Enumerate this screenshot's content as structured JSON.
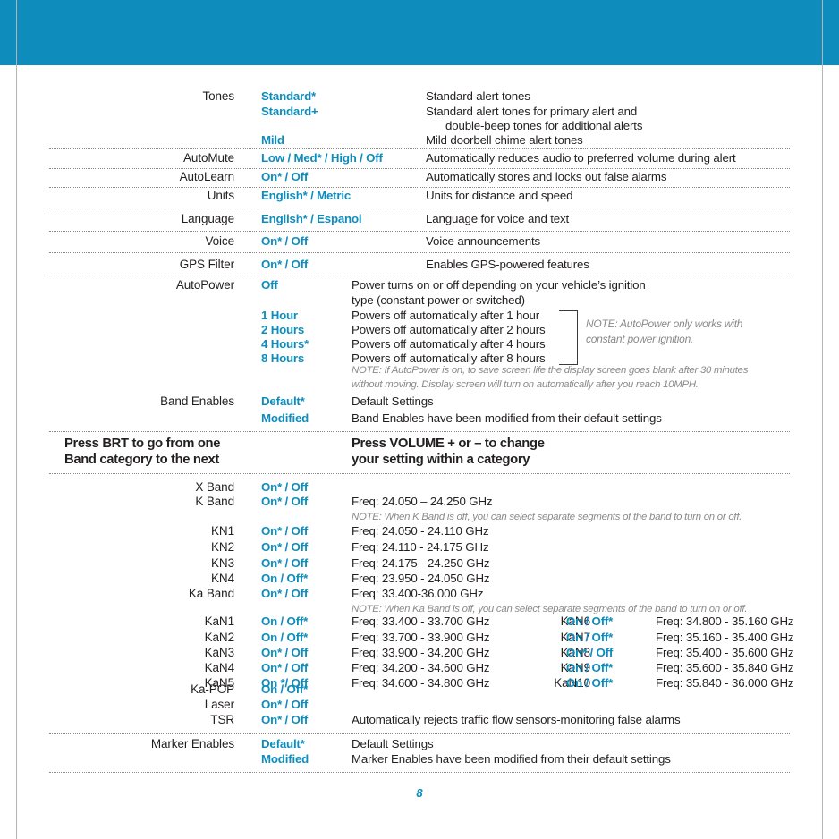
{
  "page": {
    "number": "8",
    "banner_color": "#0e8dbd",
    "accent_color": "#0e8dbd",
    "note_color": "#8a8a8a"
  },
  "settings_rows": [
    {
      "label": "Tones",
      "options": [
        "Standard*",
        "Standard+",
        "Mild"
      ],
      "descriptions": [
        "Standard alert tones",
        "Standard alert tones for primary alert and",
        "double-beep tones for additional alerts",
        "Mild doorbell chime alert tones"
      ]
    },
    {
      "label": "AutoMute",
      "option": "Low / Med* / High / Off",
      "desc": "Automatically reduces audio to preferred volume during alert"
    },
    {
      "label": "AutoLearn",
      "option": "On* / Off",
      "desc": "Automatically stores and locks out false alarms"
    },
    {
      "label": "Units",
      "option": "English* / Metric",
      "desc": "Units for distance and speed"
    },
    {
      "label": "Language",
      "option": "English* / Espanol",
      "desc": "Language for voice and text"
    },
    {
      "label": "Voice",
      "option": "On* / Off",
      "desc": "Voice announcements"
    },
    {
      "label": "GPS Filter",
      "option": "On* / Off",
      "desc": "Enables GPS-powered features"
    }
  ],
  "autopower": {
    "label": "AutoPower",
    "off_option": "Off",
    "off_desc_line1": "Power turns on or off depending on your vehicle’s ignition",
    "off_desc_line2": "type (constant power or switched)",
    "timers": [
      {
        "option": "1 Hour",
        "desc": "Powers off automatically after 1 hour"
      },
      {
        "option": "2 Hours",
        "desc": "Powers off automatically after 2 hours"
      },
      {
        "option": "4 Hours*",
        "desc": "Powers off automatically after 4 hours"
      },
      {
        "option": "8 Hours",
        "desc": "Powers off automatically after 8 hours"
      }
    ],
    "bracket_note_line1": "NOTE: AutoPower only works with",
    "bracket_note_line2": "constant power ignition.",
    "note_line1": "NOTE: If AutoPower is on, to save screen life the display screen goes blank after 30 minutes",
    "note_line2": "without moving. Display screen will turn on automatically after you reach 10MPH."
  },
  "band_enables": {
    "label": "Band Enables",
    "rows": [
      {
        "option": "Default*",
        "desc": "Default Settings"
      },
      {
        "option": "Modified",
        "desc": "Band Enables have been modified from their default settings"
      }
    ]
  },
  "instruction_header": {
    "left_line1": "Press BRT to go from one",
    "left_line2": "Band category to the next",
    "right_line1": "Press VOLUME + or – to change",
    "right_line2": "your setting within a category"
  },
  "bands": {
    "x_band": {
      "label": "X Band",
      "option": "On* / Off",
      "freq": ""
    },
    "k_band": {
      "label": "K Band",
      "option": "On* / Off",
      "freq": "Freq: 24.050 – 24.250 GHz"
    },
    "k_note": "NOTE: When K Band is off, you can select separate  segments of the band to turn on or off.",
    "k_segments": [
      {
        "label": "KN1",
        "option": "On* / Off",
        "freq": "Freq: 24.050 - 24.110 GHz"
      },
      {
        "label": "KN2",
        "option": "On* / Off",
        "freq": "Freq: 24.110 - 24.175 GHz"
      },
      {
        "label": "KN3",
        "option": "On* / Off",
        "freq": "Freq: 24.175 - 24.250 GHz"
      },
      {
        "label": "KN4",
        "option": "On / Off*",
        "freq": "Freq: 23.950 - 24.050 GHz"
      }
    ],
    "ka_band": {
      "label": "Ka Band",
      "option": "On* / Off",
      "freq": "Freq: 33.400-36.000 GHz"
    },
    "ka_note": "NOTE: When Ka Band is off, you can select separate segments of the band to turn on or off.",
    "ka_segments_left": [
      {
        "label": "KaN1",
        "option": "On / Off*",
        "freq": "Freq: 33.400 - 33.700 GHz"
      },
      {
        "label": "KaN2",
        "option": "On / Off*",
        "freq": "Freq: 33.700 - 33.900 GHz"
      },
      {
        "label": "KaN3",
        "option": "On* / Off",
        "freq": "Freq: 33.900 - 34.200 GHz"
      },
      {
        "label": "KaN4",
        "option": "On* / Off",
        "freq": "Freq: 34.200 - 34.600 GHz"
      },
      {
        "label": "KaN5",
        "option": "On */ Off",
        "freq": "Freq: 34.600 - 34.800 GHz"
      }
    ],
    "ka_segments_right": [
      {
        "label": "KaN6",
        "option": "On / Off*",
        "freq": "Freq: 34.800 - 35.160 GHz"
      },
      {
        "label": "KaN7",
        "option": "On / Off*",
        "freq": "Freq: 35.160 - 35.400 GHz"
      },
      {
        "label": "KaN8",
        "option": "On* / Off",
        "freq": "Freq: 35.400 - 35.600 GHz"
      },
      {
        "label": "KaN9",
        "option": "On / Off*",
        "freq": "Freq: 35.600 - 35.840 GHz"
      },
      {
        "label": "KaN10",
        "option": "On / Off*",
        "freq": "Freq: 35.840 - 36.000 GHz"
      }
    ],
    "tail_rows": [
      {
        "label": "Ka-POP",
        "option": "On / Off*",
        "desc": ""
      },
      {
        "label": "Laser",
        "option": "On* / Off",
        "desc": ""
      },
      {
        "label": "TSR",
        "option": "On* / Off",
        "desc": "Automatically rejects traffic flow sensors-monitoring false alarms"
      }
    ]
  },
  "marker_enables": {
    "label": "Marker Enables",
    "rows": [
      {
        "option": "Default*",
        "desc": "Default Settings"
      },
      {
        "option": "Modified",
        "desc": "Marker Enables have been modified from their default settings"
      }
    ]
  }
}
